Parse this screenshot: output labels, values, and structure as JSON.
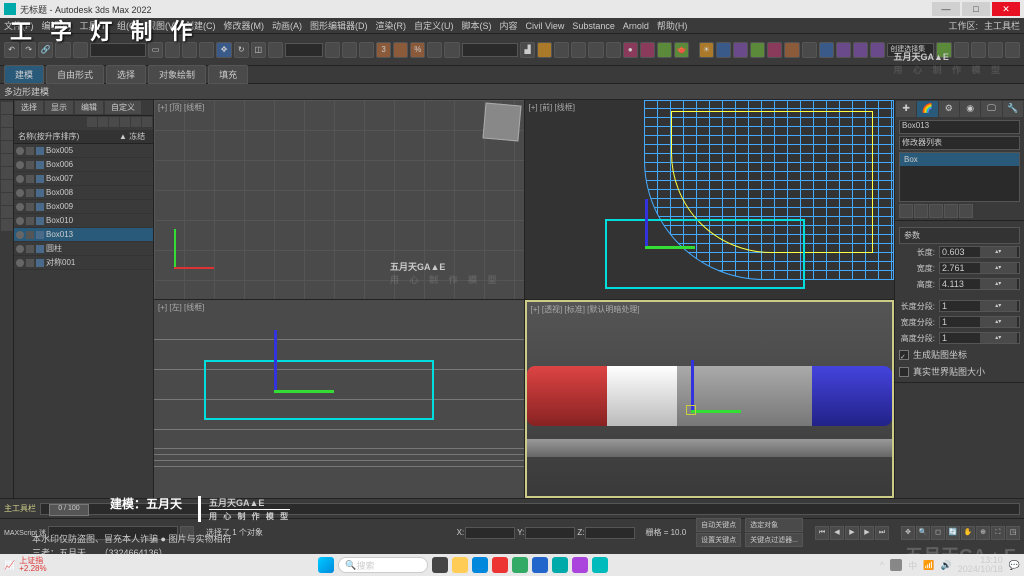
{
  "window": {
    "title": "无标题 - Autodesk 3ds Max 2022"
  },
  "overlay_title": "工 字 灯 制 作",
  "menu": {
    "items": [
      "文件(F)",
      "编辑(E)",
      "工具(T)",
      "组(G)",
      "视图(V)",
      "创建(C)",
      "修改器(M)",
      "动画(A)",
      "图形编辑器(D)",
      "渲染(R)",
      "自定义(U)",
      "脚本(S)",
      "内容",
      "Civil View",
      "Substance",
      "Arnold",
      "帮助(H)"
    ],
    "right": [
      "工作区:",
      "主工具栏"
    ]
  },
  "tabs": {
    "items": [
      "建模",
      "自由形式",
      "选择",
      "对象绘制",
      "填充"
    ],
    "active": 0
  },
  "ribbon_label": "多边形建模",
  "scene": {
    "tabs": [
      "选择",
      "显示",
      "编辑",
      "自定义"
    ],
    "cols": {
      "name": "名称(按升序排序)",
      "frozen": "▲ 冻结"
    },
    "items": [
      {
        "name": "Box005",
        "sel": false
      },
      {
        "name": "Box006",
        "sel": false
      },
      {
        "name": "Box007",
        "sel": false
      },
      {
        "name": "Box008",
        "sel": false
      },
      {
        "name": "Box009",
        "sel": false
      },
      {
        "name": "Box010",
        "sel": false
      },
      {
        "name": "Box013",
        "sel": true
      },
      {
        "name": "圆柱",
        "sel": false
      },
      {
        "name": "对称001",
        "sel": false
      }
    ]
  },
  "viewports": {
    "tl": "[+] [顶] [线框]",
    "tr": "[+] [前] [线框]",
    "bl": "[+] [左] [线框]",
    "br": "[+] [透视] [标准] [默认明暗处理]"
  },
  "cmd": {
    "obj_name": "Box013",
    "mod_label": "修改器列表",
    "mod_stack": "Box",
    "rollout": "参数",
    "params": {
      "length_l": "长度:",
      "length_v": "0.603",
      "width_l": "宽度:",
      "width_v": "2.761",
      "height_l": "高度:",
      "height_v": "4.113",
      "lseg_l": "长度分段:",
      "lseg_v": "1",
      "wseg_l": "宽度分段:",
      "wseg_v": "1",
      "hseg_l": "高度分段:",
      "hseg_v": "1"
    },
    "checks": {
      "gen_uv": "生成贴图坐标",
      "real_world": "真实世界贴图大小"
    }
  },
  "timeline": {
    "left": "主工具栏",
    "slider": "0 / 100"
  },
  "status": {
    "maxscript": "MAXScript 迷",
    "selected": "选择了 1 个对象",
    "x": "X:",
    "y": "Y:",
    "z": "Z:",
    "grid": "栅格 = 10.0",
    "autokey": "自动关键点",
    "setkey": "设置关键点",
    "filter": "选定对象",
    "keyfilter": "关键点过滤器..."
  },
  "taskbar": {
    "stock_name": "上证指",
    "stock_pct": "+2.28%",
    "search": "搜索",
    "time": "13:10",
    "date": "2024/10/18"
  },
  "watermark": {
    "brand": "五月天GA▲E",
    "sub": "用 心 制 作 模 型"
  },
  "credit": "建模：五月天",
  "disclaimer": {
    "l1": "本水印仅防盗图、冒充本人诈骗 ● 图片与实物相符",
    "l2": "三考：五月天　　（3324664136）"
  }
}
